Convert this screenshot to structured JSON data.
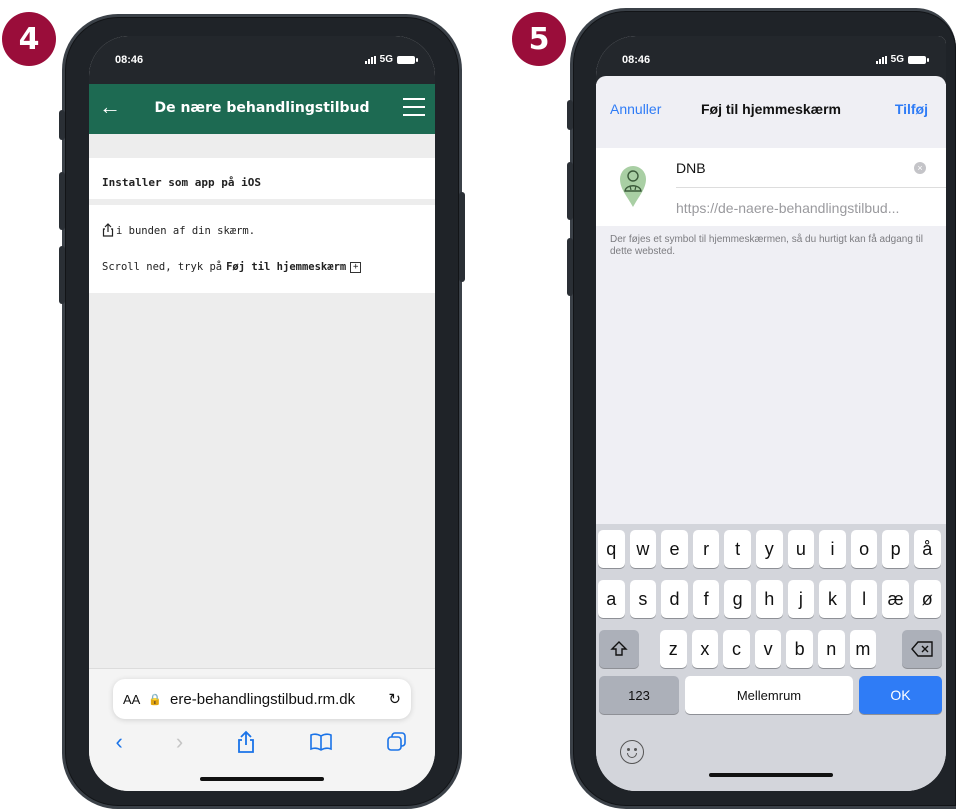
{
  "steps": {
    "left": "4",
    "right": "5"
  },
  "phone1": {
    "status": {
      "time": "08:46",
      "network": "5G"
    },
    "nav": {
      "title": "De nære behandlingstilbud"
    },
    "card_title": "Installer som app på iOS",
    "instruction1": "i bunden af din skærm.",
    "instruction2_prefix": "Scroll ned, tryk på",
    "instruction2_bold": "Føj til hjemmeskærm",
    "url": {
      "aa": "AA",
      "text": "ere-behandlingstilbud.rm.dk"
    }
  },
  "phone2": {
    "status": {
      "time": "08:46",
      "network": "5G"
    },
    "sheet": {
      "cancel": "Annuller",
      "title": "Føj til hjemmeskærm",
      "add": "Tilføj"
    },
    "name_value": "DNB",
    "url_value": "https://de-naere-behandlingstilbud...",
    "hint": "Der føjes et symbol til hjemmeskærmen, så du hurtigt kan få adgang til dette websted.",
    "keyboard": {
      "row1": [
        "q",
        "w",
        "e",
        "r",
        "t",
        "y",
        "u",
        "i",
        "o",
        "p",
        "å"
      ],
      "row2": [
        "a",
        "s",
        "d",
        "f",
        "g",
        "h",
        "j",
        "k",
        "l",
        "æ",
        "ø"
      ],
      "row3": [
        "z",
        "x",
        "c",
        "v",
        "b",
        "n",
        "m"
      ],
      "numbers": "123",
      "space": "Mellemrum",
      "ok": "OK"
    }
  },
  "colors": {
    "accent_green": "#1d6a52",
    "badge": "#9a0d3a",
    "ios_blue": "#2f7cf6"
  }
}
